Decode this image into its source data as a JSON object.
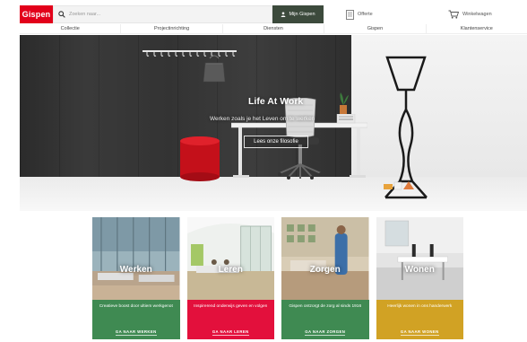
{
  "header": {
    "logo_text": "Gispen",
    "search_placeholder": "Zoeken naar...",
    "account_label": "Mijn Gispen",
    "quote_label": "Offerte",
    "cart_label": "Winkelwagen"
  },
  "nav": {
    "items": [
      "Collectie",
      "Projectinrichting",
      "Diensten",
      "Gispen",
      "Klantenservice"
    ]
  },
  "hero": {
    "title": "Life At Work",
    "subtitle": "Werken zoals je het Leven om te werken",
    "button_label": "Lees onze filosofie"
  },
  "cards": [
    {
      "title": "Werken",
      "desc": "Creatieve boost door ultiem werkgenot",
      "cta": "GA NAAR WERKEN",
      "color": "#3f8a52"
    },
    {
      "title": "Leren",
      "desc": "Inspirerend onderwijs geven en volgen",
      "cta": "GA NAAR LEREN",
      "color": "#e3103c"
    },
    {
      "title": "Zorgen",
      "desc": "Gispen ontzorgt de zorg al sinds 1916",
      "cta": "GA NAAR ZORGEN",
      "color": "#3f8a52"
    },
    {
      "title": "Wonen",
      "desc": "Heerlijk wonen in ons handerwerk",
      "cta": "GA NAAR WONEN",
      "color": "#d1a224"
    }
  ],
  "colors": {
    "brand_red": "#e2001a",
    "account_button": "#3c4a3c"
  }
}
